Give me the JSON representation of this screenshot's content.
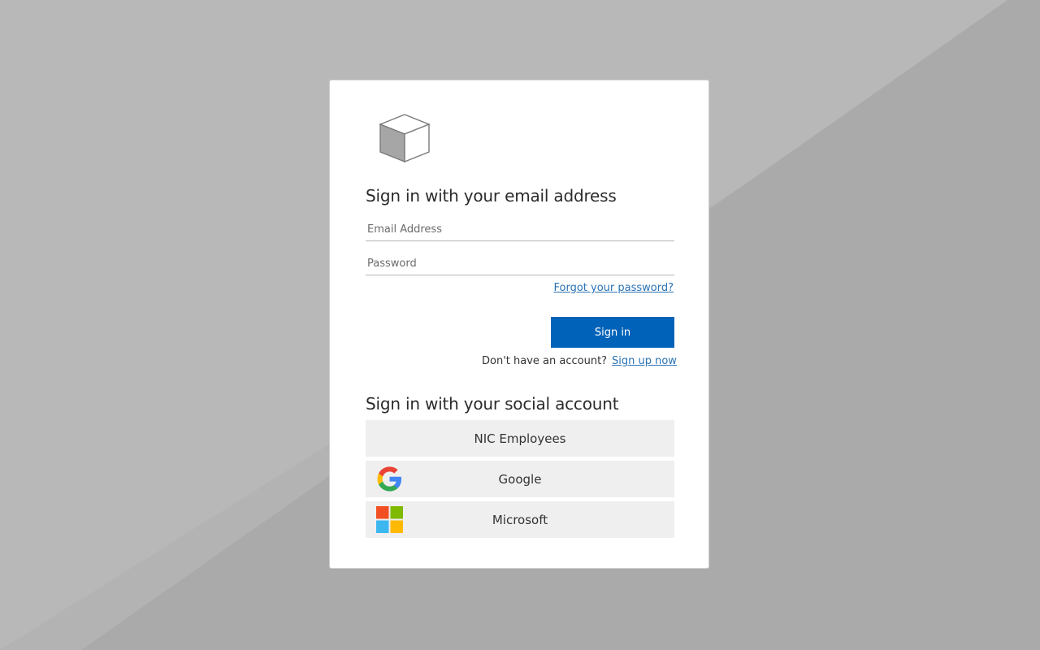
{
  "email_section": {
    "heading": "Sign in with your email address",
    "email_placeholder": "Email Address",
    "password_placeholder": "Password",
    "forgot_password_label": "Forgot your password?",
    "sign_in_label": "Sign in",
    "no_account_text": "Don't have an account?",
    "sign_up_label": "Sign up now"
  },
  "social_section": {
    "heading": "Sign in with your social account",
    "providers": [
      {
        "label": "NIC Employees",
        "icon": ""
      },
      {
        "label": "Google",
        "icon": "google-icon"
      },
      {
        "label": "Microsoft",
        "icon": "microsoft-icon"
      }
    ]
  },
  "colors": {
    "primary_button": "#0063b9",
    "link": "#2a72b5",
    "social_button_bg": "#efefef",
    "background": "#b3b3b3"
  }
}
